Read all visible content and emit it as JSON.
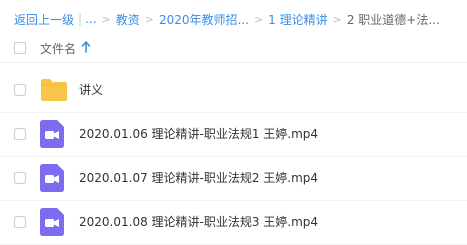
{
  "breadcrumb": {
    "back": "返回上一级",
    "ellipsis": "...",
    "items": [
      "教资",
      "2020年教师招...",
      "1 理论精讲"
    ],
    "current": "2 职业道德+法..."
  },
  "list": {
    "column_name": "文件名",
    "sort_icon": "arrow-up-icon",
    "accent_color": "#3a8ee6",
    "rows": [
      {
        "name": "讲义",
        "type": "folder",
        "icon": "folder-icon",
        "color": "#f7c54a"
      },
      {
        "name": "2020.01.06 理论精讲-职业法规1 王婷.mp4",
        "type": "video",
        "icon": "video-file-icon",
        "color": "#7b6cf0"
      },
      {
        "name": "2020.01.07 理论精讲-职业法规2 王婷.mp4",
        "type": "video",
        "icon": "video-file-icon",
        "color": "#7b6cf0"
      },
      {
        "name": "2020.01.08 理论精讲-职业法规3 王婷.mp4",
        "type": "video",
        "icon": "video-file-icon",
        "color": "#7b6cf0"
      }
    ]
  }
}
